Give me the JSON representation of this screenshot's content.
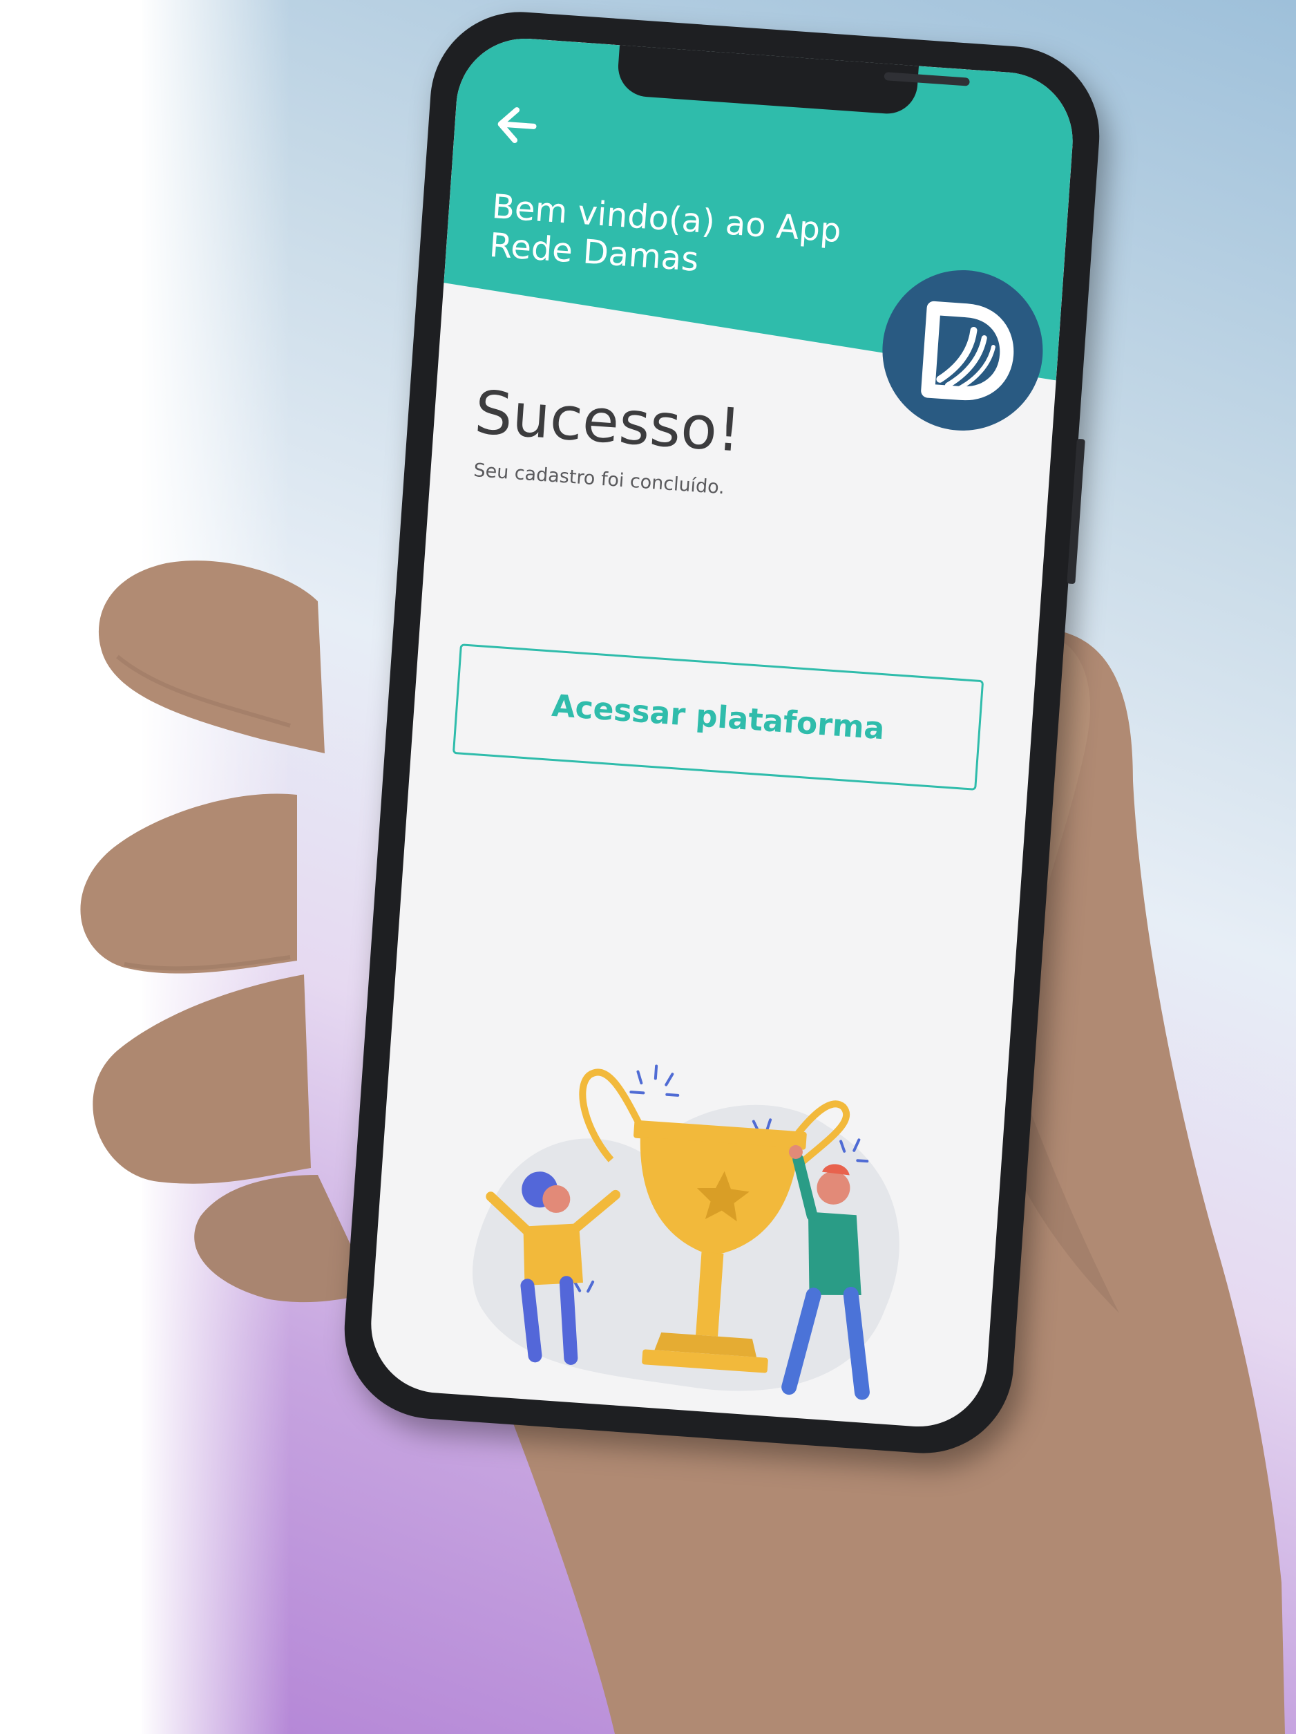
{
  "header": {
    "back_icon": "arrow-left-icon",
    "welcome_text": "Bem vindo(a) ao App Rede Damas",
    "logo_icon": "rede-damas-d-logo"
  },
  "main": {
    "title": "Sucesso!",
    "subtitle": "Seu cadastro foi concluído.",
    "primary_button_label": "Acessar plataforma"
  },
  "illustration": {
    "icon": "trophy-celebration-illustration"
  },
  "colors": {
    "accent": "#2fbcab",
    "logo_background": "#295a82",
    "screen_background": "#f4f4f5",
    "title_text": "#3c3c3e",
    "trophy": "#f2b93b"
  }
}
